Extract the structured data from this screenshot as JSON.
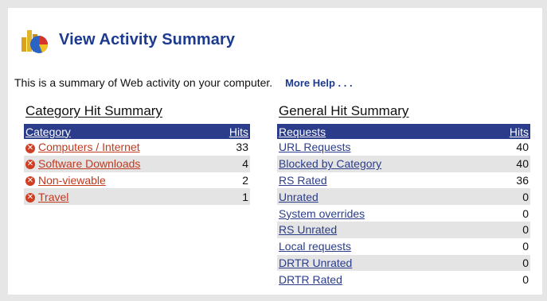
{
  "header": {
    "title": "View Activity Summary",
    "logo_icon": "activity-summary-icon"
  },
  "intro": {
    "text": "This is a summary of Web activity on your computer.",
    "help_link": "More Help . . ."
  },
  "category_summary": {
    "title": "Category Hit Summary",
    "columns": [
      "Category",
      "Hits"
    ],
    "rows": [
      {
        "label": "Computers / Internet",
        "hits": "33",
        "icon": "remove-icon"
      },
      {
        "label": "Software Downloads",
        "hits": "4",
        "icon": "remove-icon"
      },
      {
        "label": "Non-viewable",
        "hits": "2",
        "icon": "remove-icon"
      },
      {
        "label": "Travel",
        "hits": "1",
        "icon": "remove-icon"
      }
    ]
  },
  "general_summary": {
    "title": "General Hit Summary",
    "columns": [
      "Requests",
      "Hits"
    ],
    "rows": [
      {
        "label": "URL Requests",
        "hits": "40"
      },
      {
        "label": "Blocked by Category",
        "hits": "40"
      },
      {
        "label": "RS Rated",
        "hits": "36"
      },
      {
        "label": "Unrated",
        "hits": "0"
      },
      {
        "label": "System overrides",
        "hits": "0"
      },
      {
        "label": "RS Unrated",
        "hits": "0"
      },
      {
        "label": "Local requests",
        "hits": "0"
      },
      {
        "label": "DRTR Unrated",
        "hits": "0"
      },
      {
        "label": "DRTR Rated",
        "hits": "0"
      }
    ]
  },
  "colors": {
    "accent": "#1c3a8e",
    "table_header": "#2b3d8a",
    "category_link": "#c03a20",
    "row_alt": "#e4e4e4"
  }
}
